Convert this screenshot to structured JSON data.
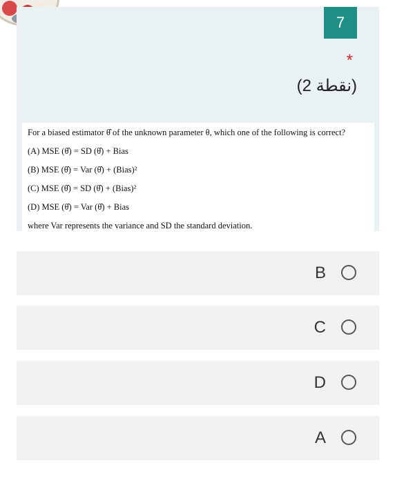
{
  "question": {
    "number": "7",
    "required_mark": "*",
    "points": "(2 نقطة)",
    "lines": [
      "For a biased estimator θ̂ of the unknown parameter θ, which one of the following is correct?",
      "(A) MSE (θ̂) = SD (θ̂) + Bias",
      "(B) MSE (θ̂) = Var (θ̂) + (Bias)²",
      "(C) MSE (θ̂) = SD (θ̂) + (Bias)²",
      "(D) MSE (θ̂) = Var (θ̂) + Bias",
      "where Var represents the variance and SD the standard deviation."
    ]
  },
  "options": [
    {
      "label": "B",
      "selected": false
    },
    {
      "label": "C",
      "selected": false
    },
    {
      "label": "D",
      "selected": false
    },
    {
      "label": "A",
      "selected": false
    }
  ],
  "colors": {
    "badge": "#1f8f86",
    "card_bg": "#e9f1f3",
    "option_bg": "#f1f1f1",
    "required": "#d22a2a"
  }
}
